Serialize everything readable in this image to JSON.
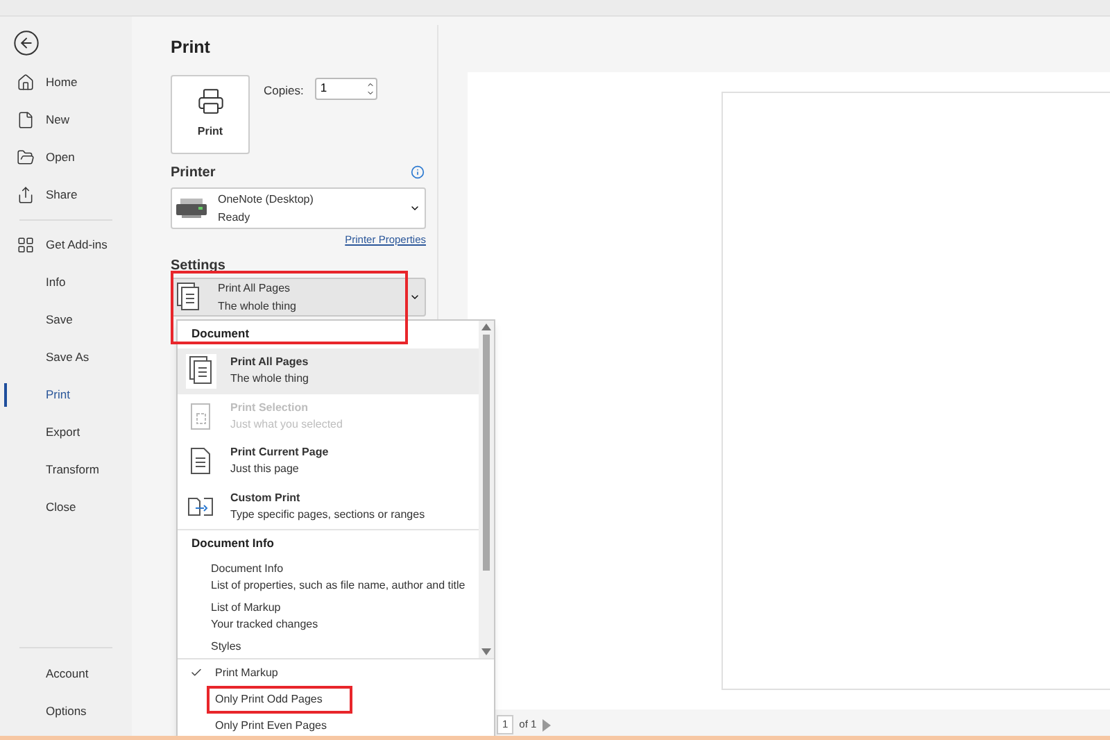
{
  "nav": {
    "top": [
      {
        "label": "Home",
        "selected": false
      },
      {
        "label": "New",
        "selected": false
      },
      {
        "label": "Open",
        "selected": false
      },
      {
        "label": "Share",
        "selected": false
      }
    ],
    "middle": [
      {
        "label": "Get Add-ins",
        "selected": false
      },
      {
        "label": "Info",
        "selected": false
      },
      {
        "label": "Save",
        "selected": false
      },
      {
        "label": "Save As",
        "selected": false
      },
      {
        "label": "Print",
        "selected": true
      },
      {
        "label": "Export",
        "selected": false
      },
      {
        "label": "Transform",
        "selected": false
      },
      {
        "label": "Close",
        "selected": false
      }
    ],
    "bottom": [
      {
        "label": "Account",
        "selected": false
      },
      {
        "label": "Options",
        "selected": false
      }
    ]
  },
  "title": "Print",
  "print_button": "Print",
  "copies": {
    "label": "Copies:",
    "value": "1"
  },
  "printer": {
    "heading": "Printer",
    "name": "OneNote (Desktop)",
    "status": "Ready",
    "link": "Printer Properties"
  },
  "settings": {
    "heading": "Settings",
    "title": "Print All Pages",
    "subtitle": "The whole thing",
    "highlighted": true
  },
  "menu": [
    {
      "kind": "header",
      "title": "Document"
    },
    {
      "kind": "option",
      "title": "Print All Pages",
      "subtitle": "The whole thing",
      "selected": true,
      "disabled": false
    },
    {
      "kind": "option",
      "title": "Print Selection",
      "subtitle": "Just what you selected",
      "selected": false,
      "disabled": true
    },
    {
      "kind": "option",
      "title": "Print Current Page",
      "subtitle": "Just this page",
      "selected": false,
      "disabled": false
    },
    {
      "kind": "option",
      "title": "Custom Print",
      "subtitle": "Type specific pages, sections or ranges",
      "selected": false,
      "disabled": false
    },
    {
      "kind": "header",
      "title": "Document Info"
    },
    {
      "kind": "plain",
      "title": "Document Info",
      "subtitle": "List of properties, such as file name, author and title"
    },
    {
      "kind": "plain",
      "title": "List of Markup",
      "subtitle": "Your tracked changes"
    },
    {
      "kind": "plain",
      "title": "Styles"
    }
  ],
  "menu_footer": [
    {
      "label": "Print Markup",
      "checked": true,
      "highlighted": false
    },
    {
      "label": "Only Print Odd Pages",
      "checked": false,
      "highlighted": true
    },
    {
      "label": "Only Print Even Pages",
      "checked": false,
      "highlighted": false
    }
  ],
  "pager": {
    "page": "1",
    "total": "of 1"
  }
}
